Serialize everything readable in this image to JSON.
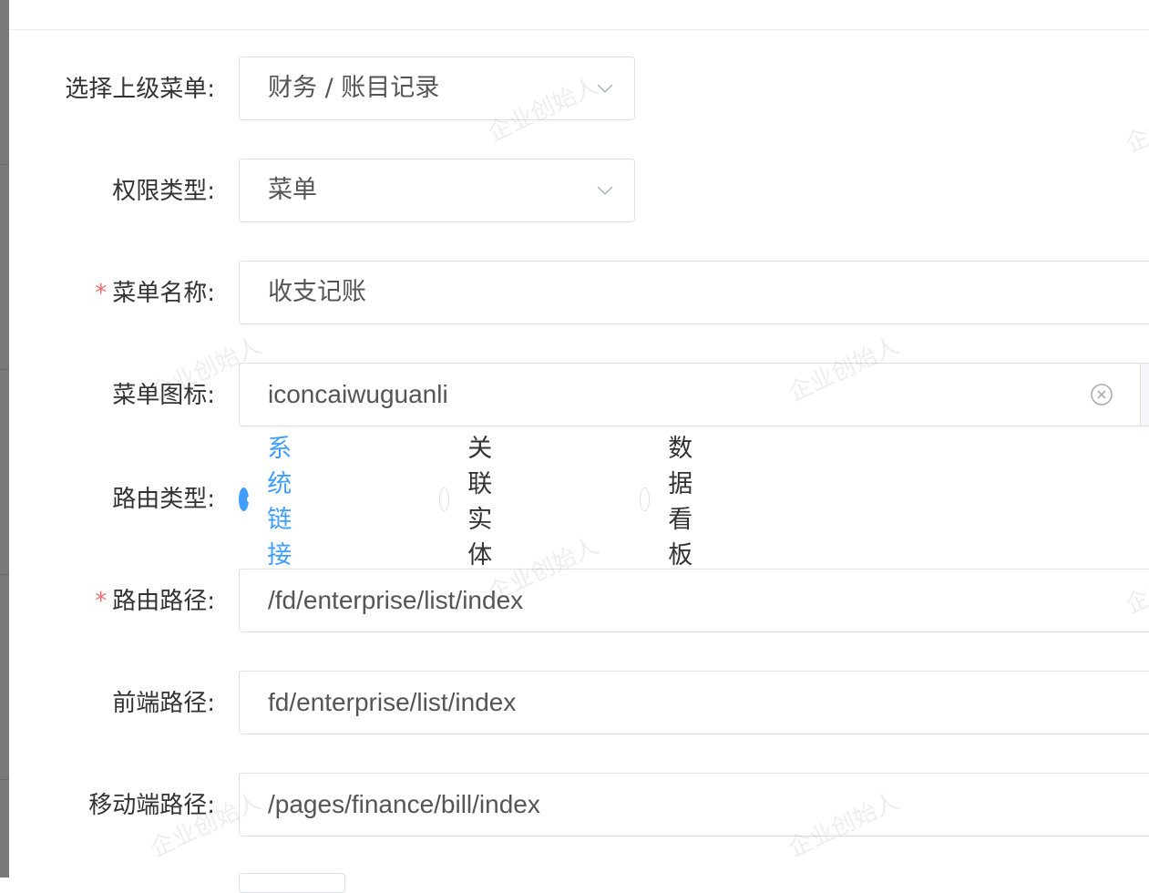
{
  "form": {
    "parent_menu": {
      "label": "选择上级菜单:",
      "value": "财务 / 账目记录"
    },
    "permission_type": {
      "label": "权限类型:",
      "value": "菜单"
    },
    "menu_name": {
      "label": "菜单名称:",
      "required_mark": "*",
      "value": "收支记账"
    },
    "menu_icon": {
      "label": "菜单图标:",
      "value": "iconcaiwuguanli"
    },
    "route_type": {
      "label": "路由类型:",
      "options": [
        "系统链接",
        "关联实体",
        "数据看板"
      ],
      "selected": "系统链接"
    },
    "route_path": {
      "label": "路由路径:",
      "required_mark": "*",
      "value": "/fd/enterprise/list/index"
    },
    "frontend_path": {
      "label": "前端路径:",
      "value": "fd/enterprise/list/index"
    },
    "mobile_path": {
      "label": "移动端路径:",
      "value": "/pages/finance/bill/index"
    }
  },
  "watermark_text": "企业创始人",
  "colors": {
    "accent": "#409eff",
    "required": "#f56c6c",
    "border": "#dcdfe6",
    "text": "#333333"
  },
  "icons": {
    "select_arrow": "chevron-down-icon",
    "clear": "circle-close-icon"
  }
}
